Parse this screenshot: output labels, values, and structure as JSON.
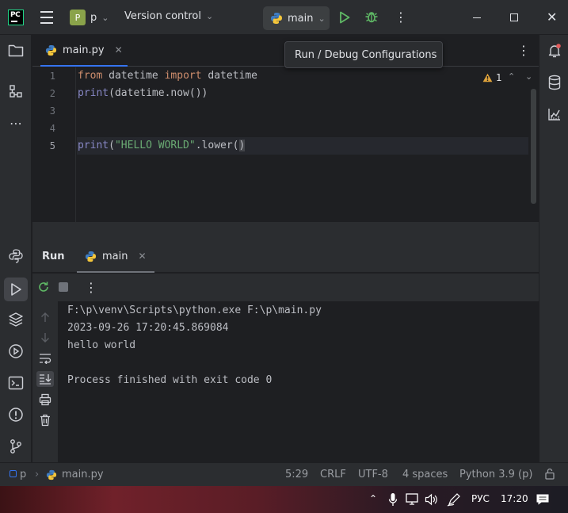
{
  "titlebar": {
    "logo_text": "PC",
    "project_badge": "P",
    "project_name": "p",
    "version_control": "Version control",
    "run_config": "main",
    "more": "⋮",
    "close": "✕"
  },
  "editor": {
    "tab_label": "main.py",
    "tab_close": "✕",
    "tab_more": "⋮",
    "tooltip": "Run / Debug Configurations",
    "warnings_count": "1",
    "line_numbers": [
      "1",
      "2",
      "3",
      "4",
      "5"
    ],
    "lines": {
      "l1_kw1": "from",
      "l1_mod": " datetime ",
      "l1_kw2": "import",
      "l1_name": " datetime",
      "l2_fn": "print",
      "l2_rest": "(datetime.now())",
      "l5_fn": "print",
      "l5_open": "(",
      "l5_str": "\"HELLO WORLD\"",
      "l5_rest": ".lower(",
      "l5_close": ")"
    }
  },
  "run_panel": {
    "title": "Run",
    "tab_label": "main",
    "tab_close": "✕",
    "more": "⋮",
    "output": [
      "F:\\p\\venv\\Scripts\\python.exe F:\\p\\main.py",
      "2023-09-26 17:20:45.869084",
      "hello world",
      "",
      "Process finished with exit code 0"
    ]
  },
  "statusbar": {
    "project": "p",
    "file": "main.py",
    "position": "5:29",
    "line_sep": "CRLF",
    "encoding": "UTF-8",
    "indent": "4 spaces",
    "interpreter": "Python 3.9 (p)"
  },
  "taskbar": {
    "lang": "РУС",
    "time": "17:20"
  },
  "colors": {
    "accent": "#3574f0",
    "run_green": "#5fb865",
    "warning": "#e0a33b",
    "keyword": "#cf8e6d",
    "string": "#6aab73"
  }
}
